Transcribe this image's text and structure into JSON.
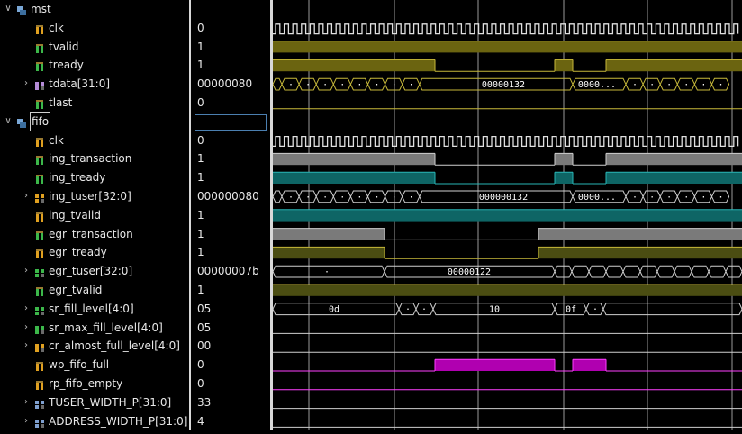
{
  "colors": {
    "clk": "#e0e0e0",
    "yellow": "#6b6410",
    "yellowLine": "#c7b93a",
    "white": "#cfcfcf",
    "grayFill": "#7a7a7a",
    "teal": "#0e6565",
    "tealLine": "#28b6b6",
    "olive": "#4b4d12",
    "magenta": "#b000b0",
    "magentaLine": "#ff40ff",
    "gridline": "#9a9a9a"
  },
  "signals": [
    {
      "kind": "group",
      "name": "mst",
      "value": "",
      "icon": "group-icon",
      "depth": 0
    },
    {
      "kind": "bit",
      "name": "clk",
      "value": "0",
      "icon": "bit-icon-orange",
      "depth": 1
    },
    {
      "kind": "bit",
      "name": "tvalid",
      "value": "1",
      "icon": "bit-icon-green",
      "depth": 1
    },
    {
      "kind": "bit",
      "name": "tready",
      "value": "1",
      "icon": "bit-icon-green",
      "depth": 1
    },
    {
      "kind": "bus",
      "name": "tdata[31:0]",
      "value": "00000080",
      "icon": "bus-icon-purple",
      "depth": 1
    },
    {
      "kind": "bit",
      "name": "tlast",
      "value": "0",
      "icon": "bit-icon-green",
      "depth": 1
    },
    {
      "kind": "group",
      "name": "fifo",
      "value": "",
      "icon": "group-icon",
      "depth": 0
    },
    {
      "kind": "bit",
      "name": "clk",
      "value": "0",
      "icon": "bit-icon-orange",
      "depth": 1
    },
    {
      "kind": "bit",
      "name": "ing_transaction",
      "value": "1",
      "icon": "bit-icon-green",
      "depth": 1
    },
    {
      "kind": "bit",
      "name": "ing_tready",
      "value": "1",
      "icon": "bit-icon-green",
      "depth": 1
    },
    {
      "kind": "bus",
      "name": "ing_tuser[32:0]",
      "value": "000000080",
      "icon": "bus-icon-orange",
      "depth": 1
    },
    {
      "kind": "bit",
      "name": "ing_tvalid",
      "value": "1",
      "icon": "bit-icon-orange",
      "depth": 1
    },
    {
      "kind": "bit",
      "name": "egr_transaction",
      "value": "1",
      "icon": "bit-icon-green",
      "depth": 1
    },
    {
      "kind": "bit",
      "name": "egr_tready",
      "value": "1",
      "icon": "bit-icon-orange",
      "depth": 1
    },
    {
      "kind": "bus",
      "name": "egr_tuser[32:0]",
      "value": "00000007b",
      "icon": "bus-icon-green",
      "depth": 1
    },
    {
      "kind": "bit",
      "name": "egr_tvalid",
      "value": "1",
      "icon": "bit-icon-green",
      "depth": 1
    },
    {
      "kind": "bus",
      "name": "sr_fill_level[4:0]",
      "value": "05",
      "icon": "bus-icon-green",
      "depth": 1
    },
    {
      "kind": "bus",
      "name": "sr_max_fill_level[4:0]",
      "value": "05",
      "icon": "bus-icon-green",
      "depth": 1
    },
    {
      "kind": "bus",
      "name": "cr_almost_full_level[4:0]",
      "value": "00",
      "icon": "bus-icon-orange",
      "depth": 1
    },
    {
      "kind": "bit",
      "name": "wp_fifo_full",
      "value": "0",
      "icon": "bit-icon-orange",
      "depth": 1
    },
    {
      "kind": "bit",
      "name": "rp_fifo_empty",
      "value": "0",
      "icon": "bit-icon-orange",
      "depth": 1
    },
    {
      "kind": "bus",
      "name": "TUSER_WIDTH_P[31:0]",
      "value": "33",
      "icon": "param-icon",
      "depth": 1
    },
    {
      "kind": "bus",
      "name": "ADDRESS_WIDTH_P[31:0]",
      "value": "4",
      "icon": "param-icon",
      "depth": 1
    }
  ],
  "waves": {
    "tdata_labels": [
      "00000132",
      "0000..."
    ],
    "ing_tuser_labels": [
      "000000132",
      "0000..."
    ],
    "egr_tuser_labels": [
      "00000122"
    ],
    "sr_fill_labels": [
      "0d",
      "10",
      "0f"
    ]
  }
}
